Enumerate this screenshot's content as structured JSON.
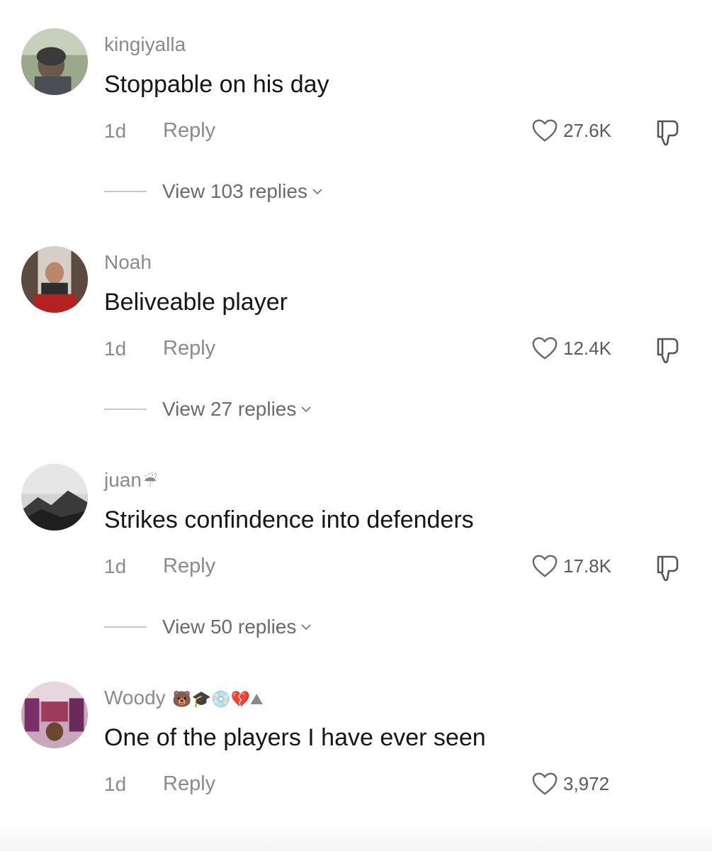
{
  "comments": [
    {
      "username": "kingiyalla",
      "username_emoji": "",
      "text": "Stoppable on his day",
      "time": "1d",
      "reply_label": "Reply",
      "likes": "27.6K",
      "view_replies": "View 103 replies",
      "avatar_colors": [
        "#8a9a7a",
        "#4a4a4a",
        "#c9b9a0"
      ]
    },
    {
      "username": "Noah",
      "username_emoji": "",
      "text": "Beliveable player",
      "time": "1d",
      "reply_label": "Reply",
      "likes": "12.4K",
      "view_replies": "View 27 replies",
      "avatar_colors": [
        "#d9d4cf",
        "#2a2a2a",
        "#b0201e"
      ]
    },
    {
      "username": "juan",
      "username_emoji": "☔",
      "text": "Strikes confindence into defenders",
      "time": "1d",
      "reply_label": "Reply",
      "likes": "17.8K",
      "view_replies": "View 50 replies",
      "avatar_colors": [
        "#cfcfcf",
        "#3a3a3a",
        "#6e6e6e"
      ]
    },
    {
      "username": "Woody",
      "username_emoji": "🐻🎓💿💔⛰",
      "text": "One of the players I have ever seen",
      "time": "1d",
      "reply_label": "Reply",
      "likes": "3,972",
      "view_replies": "",
      "avatar_colors": [
        "#7a2f6a",
        "#d6b8c8",
        "#3a1a2a"
      ]
    }
  ]
}
